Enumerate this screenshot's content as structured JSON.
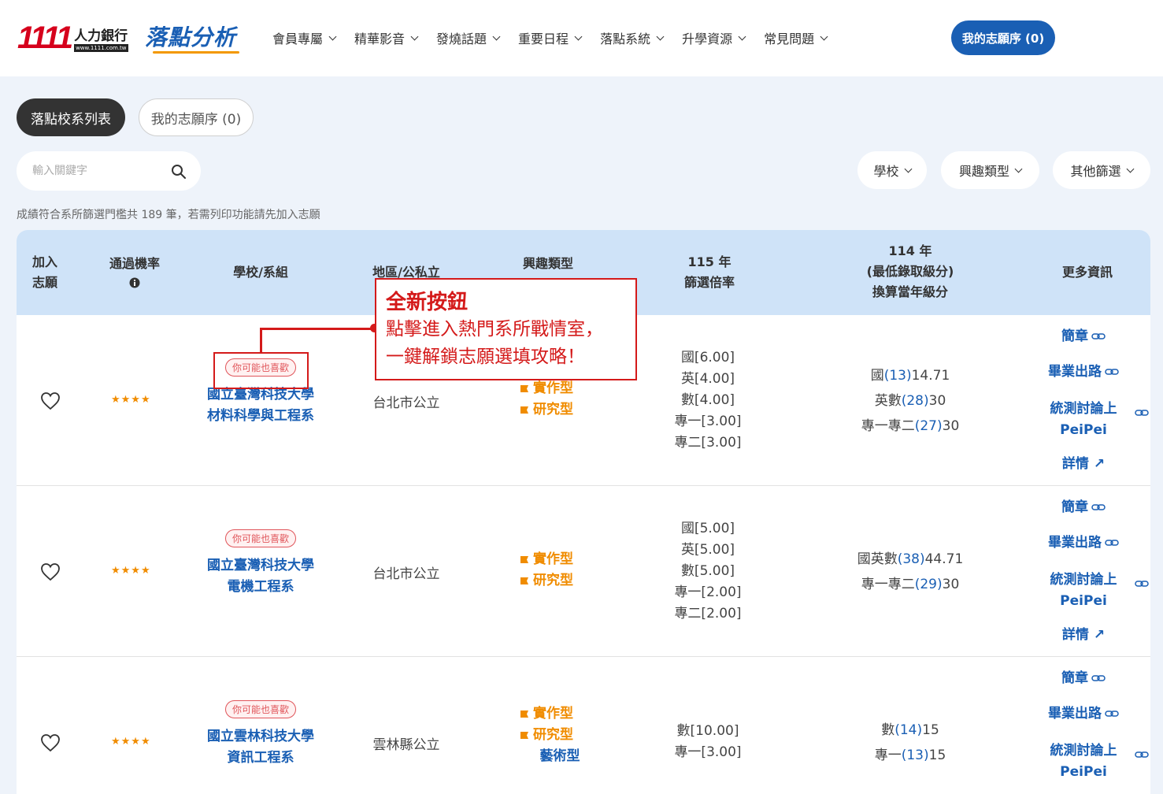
{
  "header": {
    "logo_number": "1111",
    "logo_title": "人力銀行",
    "logo_url": "www.1111.com.tw",
    "brand": "落點分析",
    "nav": [
      "會員專屬",
      "精華影音",
      "發燒話題",
      "重要日程",
      "落點系統",
      "升學資源",
      "常見問題"
    ],
    "my_wish_button": "我的志願序 (0)"
  },
  "tabs": {
    "active": "落點校系列表",
    "inactive": "我的志願序 (0)"
  },
  "search": {
    "placeholder": "輸入關鍵字"
  },
  "filters": [
    "學校",
    "興趣類型",
    "其他篩選"
  ],
  "count_text": "成績符合系所篩選門檻共 189 筆，若需列印功能請先加入志願",
  "table": {
    "headers": {
      "add": [
        "加入",
        "志願"
      ],
      "pass_rate": "通過機率",
      "school": "學校/系組",
      "region": "地區/公私立",
      "interest": "興趣類型",
      "ratio": [
        "115 年",
        "篩選倍率"
      ],
      "score": [
        "114 年",
        "(最低錄取級分)",
        "換算當年級分"
      ],
      "more": "更多資訊"
    },
    "rows": [
      {
        "stars": "★★★★",
        "badge": "你可能也喜歡",
        "school": [
          "國立臺灣科技大學",
          "材料科學與工程系"
        ],
        "region": "台北市公立",
        "interests": [
          "實作型",
          "研究型"
        ],
        "interest_plain": "",
        "ratios": [
          "國[6.00]",
          "英[4.00]",
          "數[4.00]",
          "專一[3.00]",
          "專二[3.00]"
        ],
        "scores": [
          {
            "label": "國",
            "rank": "(13)",
            "value": "14.71"
          },
          {
            "label": "英數",
            "rank": "(28)",
            "value": "30"
          },
          {
            "label": "專一專二",
            "rank": "(27)",
            "value": "30"
          }
        ]
      },
      {
        "stars": "★★★★",
        "badge": "你可能也喜歡",
        "school": [
          "國立臺灣科技大學",
          "電機工程系"
        ],
        "region": "台北市公立",
        "interests": [
          "實作型",
          "研究型"
        ],
        "interest_plain": "",
        "ratios": [
          "國[5.00]",
          "英[5.00]",
          "數[5.00]",
          "專一[2.00]",
          "專二[2.00]"
        ],
        "scores": [
          {
            "label": "國英數",
            "rank": "(38)",
            "value": "44.71"
          },
          {
            "label": "專一專二",
            "rank": "(29)",
            "value": "30"
          }
        ]
      },
      {
        "stars": "★★★★",
        "badge": "你可能也喜歡",
        "school": [
          "國立雲林科技大學",
          "資訊工程系"
        ],
        "region": "雲林縣公立",
        "interests": [
          "實作型",
          "研究型"
        ],
        "interest_plain": "藝術型",
        "ratios": [
          "數[10.00]",
          "專一[3.00]"
        ],
        "scores": [
          {
            "label": "數",
            "rank": "(14)",
            "value": "15"
          },
          {
            "label": "專一",
            "rank": "(13)",
            "value": "15"
          }
        ]
      }
    ],
    "more_links": {
      "brochure": "簡章",
      "career": "畢業出路",
      "forum_line1": "統測討論上",
      "forum_line2": "PeiPei",
      "details": "詳情 ↗"
    }
  },
  "annotation": {
    "title": "全新按鈕",
    "line1": "點擊進入熱門系所戰情室，",
    "line2": "一鍵解鎖志願選填攻略！"
  }
}
